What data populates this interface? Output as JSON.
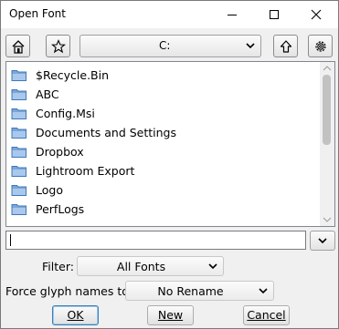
{
  "window": {
    "title": "Open Font"
  },
  "toolbar": {
    "home_icon": "home-icon",
    "bookmark_icon": "star-icon",
    "drive": "C:",
    "up_icon": "up-arrow-icon",
    "settings_icon": "gear-icon"
  },
  "file_list": {
    "items": [
      {
        "name": "$Recycle.Bin",
        "icon": "folder-icon"
      },
      {
        "name": "ABC",
        "icon": "folder-icon"
      },
      {
        "name": "Config.Msi",
        "icon": "folder-icon"
      },
      {
        "name": "Documents and Settings",
        "icon": "folder-icon"
      },
      {
        "name": "Dropbox",
        "icon": "folder-icon"
      },
      {
        "name": "Lightroom Export",
        "icon": "folder-icon"
      },
      {
        "name": "Logo",
        "icon": "folder-icon"
      },
      {
        "name": "PerfLogs",
        "icon": "folder-icon"
      }
    ]
  },
  "path_input": {
    "value": ""
  },
  "filter": {
    "label": "Filter:",
    "value": "All Fonts"
  },
  "glyph_names": {
    "label": "Force glyph names to:",
    "value": "No Rename"
  },
  "buttons": {
    "ok": "OK",
    "new": "New",
    "cancel": "Cancel"
  },
  "colors": {
    "folder": "#7aa7d9",
    "folder_dark": "#3f78b8",
    "default_button_border": "#3c7fb1"
  }
}
